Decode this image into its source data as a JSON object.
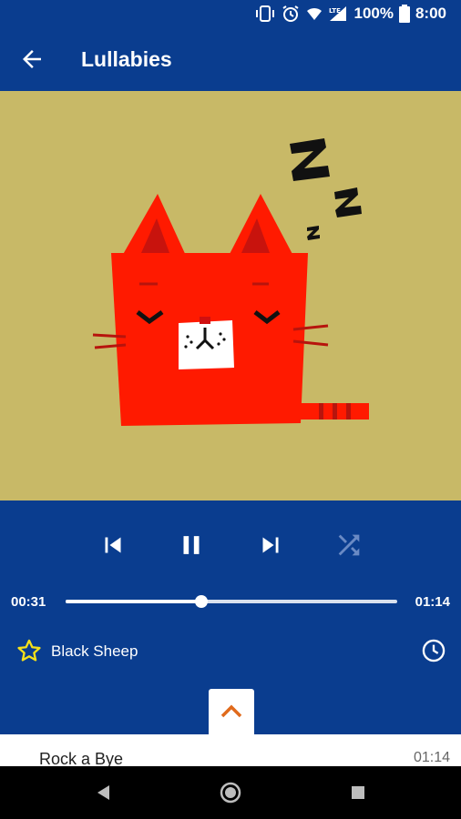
{
  "status_bar": {
    "battery": "100%",
    "time": "8:00",
    "network": "LTE"
  },
  "app_bar": {
    "title": "Lullabies"
  },
  "artwork": {
    "icon": "sleeping-cat-illustration",
    "background": "#c8b967",
    "zzz": "Zzz"
  },
  "player": {
    "current_time": "00:31",
    "duration": "01:14",
    "progress": 0.41,
    "song_title": "Black Sheep",
    "shuffle_enabled": false
  },
  "queue": [
    {
      "title": "Rock a Bye",
      "duration": "01:14"
    }
  ],
  "colors": {
    "primary": "#0a3d8f",
    "accent": "#e06a1c",
    "star": "#f5e11a"
  }
}
